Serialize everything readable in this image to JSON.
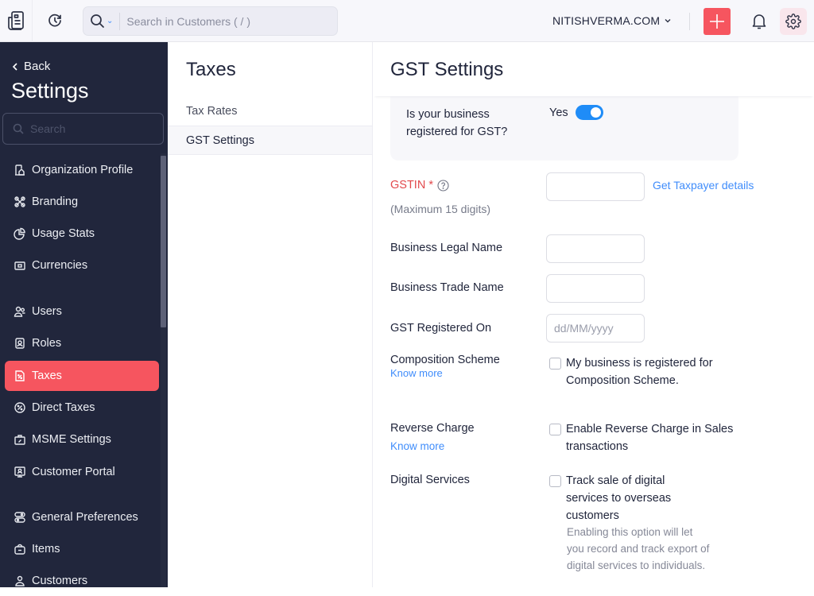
{
  "topbar": {
    "search_placeholder": "Search in Customers ( / )",
    "org_name": "NITISHVERMA.COM",
    "icons": [
      "app-logo-icon",
      "history-icon",
      "search-icon",
      "chevron-down-icon",
      "plus-icon",
      "bell-icon",
      "gear-icon"
    ]
  },
  "sidebar": {
    "back_label": "Back",
    "title": "Settings",
    "search_placeholder": "Search",
    "items": [
      {
        "label": "Organization Profile",
        "icon": "building-icon"
      },
      {
        "label": "Branding",
        "icon": "brush-icon"
      },
      {
        "label": "Usage Stats",
        "icon": "pie-chart-icon"
      },
      {
        "label": "Currencies",
        "icon": "money-icon"
      },
      {
        "label": "Users",
        "icon": "users-icon"
      },
      {
        "label": "Roles",
        "icon": "badge-icon"
      },
      {
        "label": "Taxes",
        "icon": "tax-document-icon",
        "active": true
      },
      {
        "label": "Direct Taxes",
        "icon": "percent-circle-icon"
      },
      {
        "label": "MSME Settings",
        "icon": "briefcase-icon"
      },
      {
        "label": "Customer Portal",
        "icon": "monitor-user-icon"
      },
      {
        "label": "General Preferences",
        "icon": "preferences-icon"
      },
      {
        "label": "Items",
        "icon": "bag-icon"
      },
      {
        "label": "Customers",
        "icon": "user-icon"
      }
    ]
  },
  "taxes_panel": {
    "title": "Taxes",
    "items": [
      {
        "label": "Tax Rates"
      },
      {
        "label": "GST Settings",
        "selected": true
      }
    ]
  },
  "gst": {
    "title": "GST Settings",
    "registered_question": "Is your business registered for GST?",
    "registered_value": "Yes",
    "registered_on": true,
    "gstin_label": "GSTIN *",
    "gstin_hint": "(Maximum 15 digits)",
    "gstin_value": "",
    "taxpayer_link": "Get Taxpayer details",
    "legal_name_label": "Business Legal Name",
    "legal_name_value": "",
    "trade_name_label": "Business Trade Name",
    "trade_name_value": "",
    "registered_on_label": "GST Registered On",
    "registered_on_placeholder": "dd/MM/yyyy",
    "composition_label": "Composition Scheme",
    "composition_link": "Know more",
    "composition_checkbox": "My business is registered for Composition Scheme.",
    "composition_checked": false,
    "reverse_label": "Reverse Charge",
    "reverse_link": "Know more",
    "reverse_checkbox": "Enable Reverse Charge in Sales transactions",
    "reverse_checked": false,
    "digital_label": "Digital Services",
    "digital_checkbox": "Track sale of digital services to overseas customers",
    "digital_checked": false,
    "digital_hint": "Enabling this option will let you record and track export of digital services to individuals."
  },
  "colors": {
    "accent_red": "#f6555f",
    "sidebar_bg": "#21263c",
    "toggle_blue": "#1f8cf7",
    "link_blue": "#408dfb",
    "required_red": "#e2494c"
  }
}
